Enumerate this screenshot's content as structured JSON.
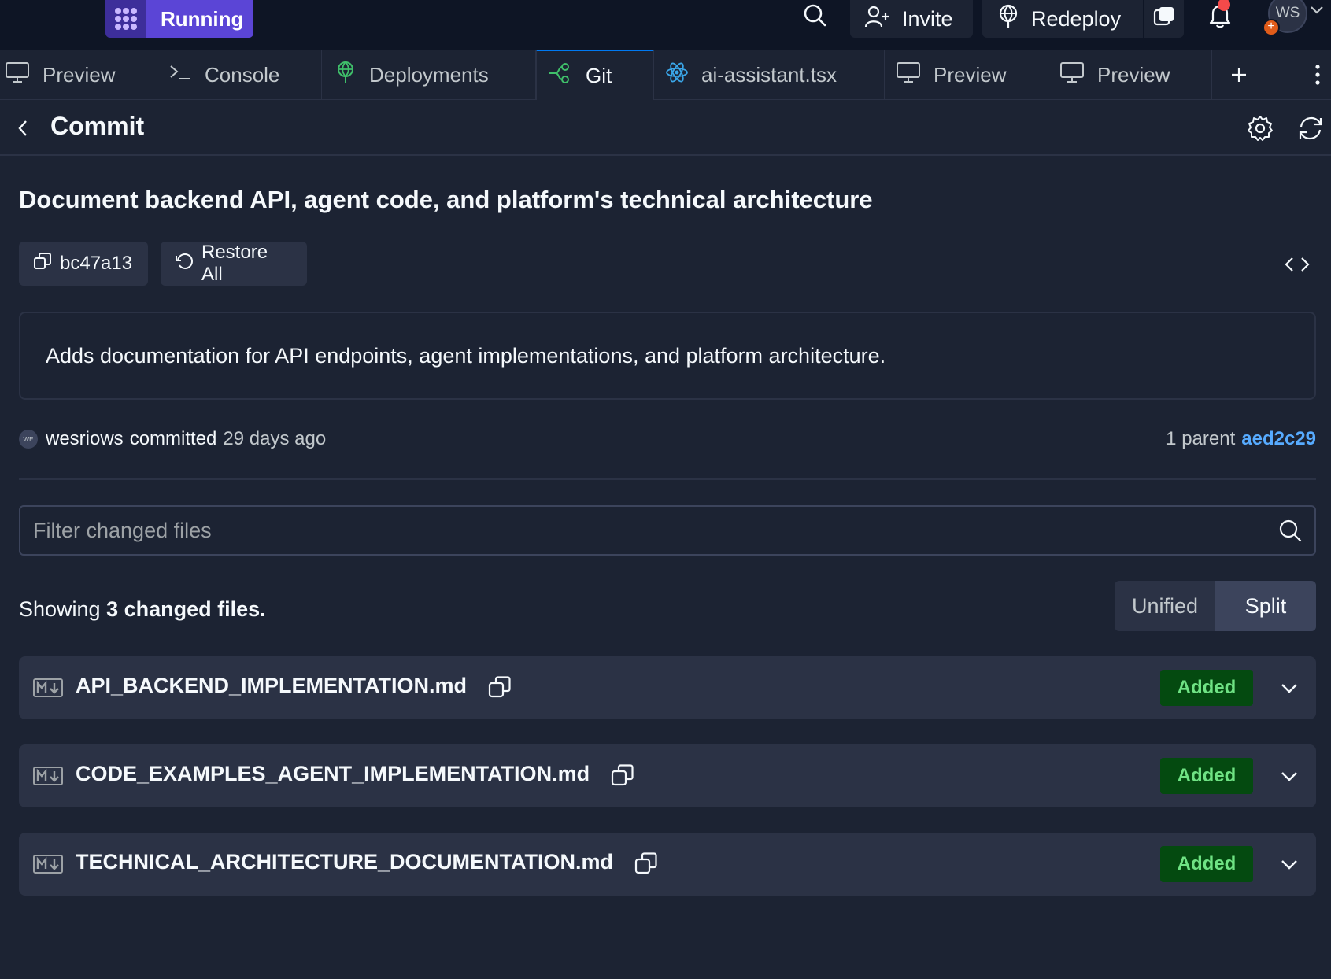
{
  "topbar": {
    "run_label": "Running",
    "invite_label": "Invite",
    "redeploy_label": "Redeploy",
    "avatar_initials": "WS",
    "avatar_badge": "+"
  },
  "tabs": [
    {
      "label": "Preview",
      "icon": "monitor-icon"
    },
    {
      "label": ">_",
      "text": "Console",
      "icon": "terminal-icon"
    },
    {
      "label": "Deployments",
      "icon": "deploy-icon"
    },
    {
      "label": "Git",
      "icon": "git-icon",
      "active": true
    },
    {
      "label": "ai-assistant.tsx",
      "icon": "react-icon"
    },
    {
      "label": "Preview",
      "icon": "monitor-icon"
    },
    {
      "label": "Preview",
      "icon": "monitor-icon"
    }
  ],
  "header": {
    "title": "Commit"
  },
  "commit": {
    "title": "Document backend API, agent code, and platform's technical architecture",
    "hash": "bc47a13",
    "restore_label": "Restore All",
    "message": "Adds documentation for API endpoints, agent implementations, and platform architecture.",
    "author_avatar": "WE",
    "author": "wesriows",
    "verb": "committed",
    "time": "29 days ago",
    "parent_label": "1 parent",
    "parent_hash": "aed2c29"
  },
  "filter": {
    "placeholder": "Filter changed files"
  },
  "summary": {
    "prefix": "Showing",
    "count_text": "3 changed files."
  },
  "view_toggle": {
    "unified": "Unified",
    "split": "Split",
    "selected": "Split"
  },
  "files": [
    {
      "name": "API_BACKEND_IMPLEMENTATION.md",
      "status": "Added"
    },
    {
      "name": "CODE_EXAMPLES_AGENT_IMPLEMENTATION.md",
      "status": "Added"
    },
    {
      "name": "TECHNICAL_ARCHITECTURE_DOCUMENTATION.md",
      "status": "Added"
    }
  ],
  "colors": {
    "background": "#1c2333",
    "topbar": "#0e1525",
    "surface": "#2b3245",
    "accent": "#0079f2",
    "run": "#5b45d6",
    "added_bg": "#044a10",
    "added_text": "#6fe384",
    "link": "#57abff"
  }
}
